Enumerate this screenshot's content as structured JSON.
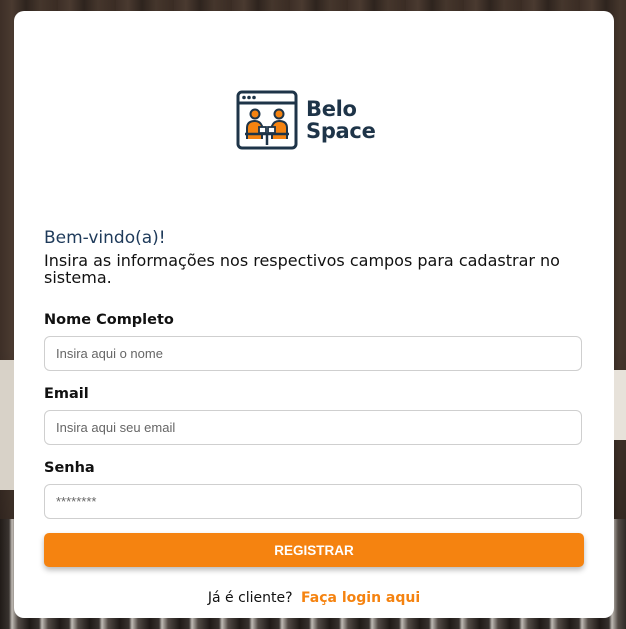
{
  "brand": {
    "name_line1": "Belo",
    "name_line2": "Space",
    "logo_icon": "coworking-window-icon"
  },
  "colors": {
    "primary": "#F58310",
    "brand_navy": "#1E3448"
  },
  "welcome": {
    "title": "Bem-vindo(a)!",
    "subtitle": "Insira as informações nos respectivos campos para cadastrar no sistema."
  },
  "form": {
    "name": {
      "label": "Nome Completo",
      "placeholder": "Insira aqui o nome",
      "value": ""
    },
    "email": {
      "label": "Email",
      "placeholder": "Insira aqui seu email",
      "value": ""
    },
    "password": {
      "label": "Senha",
      "placeholder": "********",
      "value": ""
    },
    "submit_label": "REGISTRAR"
  },
  "footer": {
    "prompt": "Já é cliente?",
    "link_label": "Faça login aqui"
  }
}
